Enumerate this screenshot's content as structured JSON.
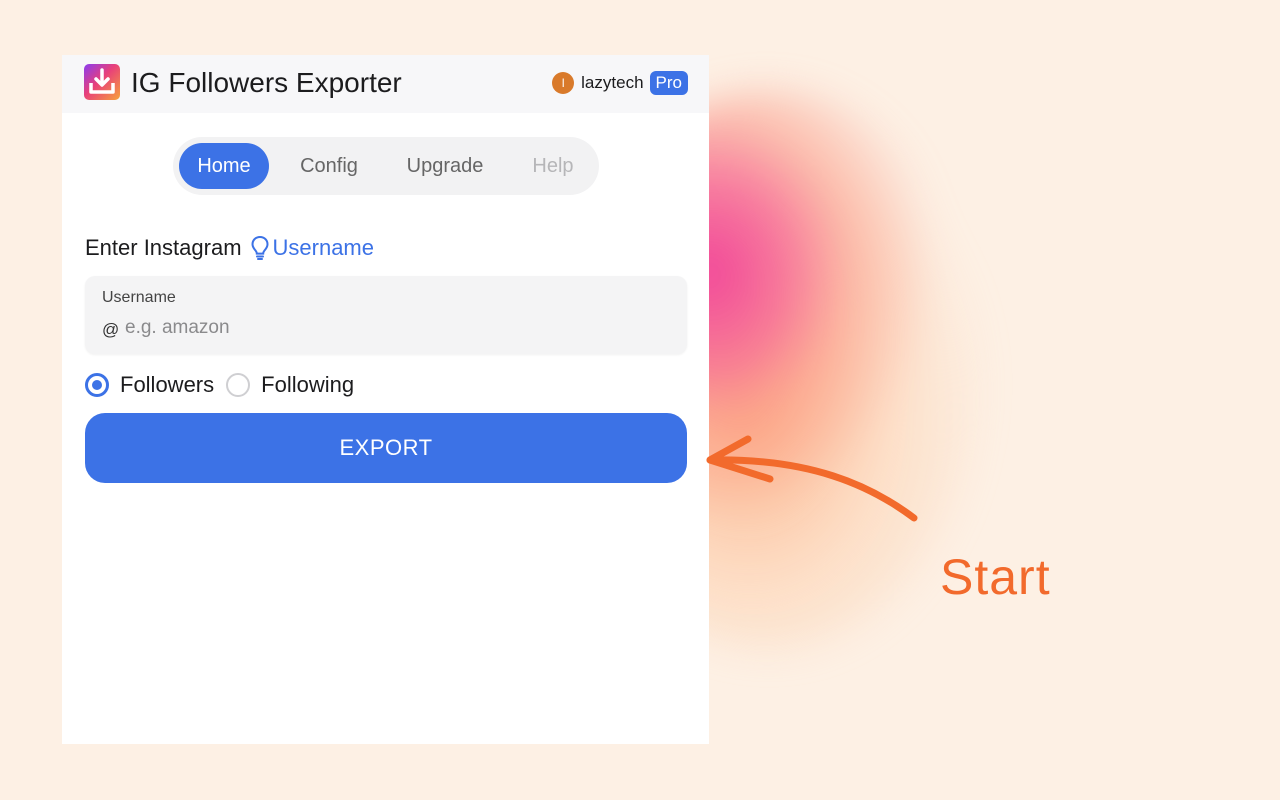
{
  "header": {
    "app_title": "IG Followers Exporter",
    "logo_icon": "download-tray-icon",
    "user": {
      "avatar_initial": "l",
      "name": "lazytech",
      "plan_badge": "Pro"
    }
  },
  "tabs": [
    {
      "label": "Home",
      "active": true
    },
    {
      "label": "Config",
      "active": false
    },
    {
      "label": "Upgrade",
      "active": false
    },
    {
      "label": "Help",
      "active": false,
      "disabled": true
    }
  ],
  "form": {
    "section_label_prefix": "Enter Instagram",
    "section_label_link": "Username",
    "hint_icon": "lightbulb-icon",
    "input": {
      "label": "Username",
      "prefix": "@",
      "value": "",
      "placeholder": "e.g. amazon"
    },
    "mode_options": [
      {
        "label": "Followers",
        "checked": true
      },
      {
        "label": "Following",
        "checked": false
      }
    ],
    "submit_label": "EXPORT"
  },
  "annotation": {
    "callout_text": "Start",
    "arrow_icon": "curved-arrow-icon"
  },
  "colors": {
    "accent": "#3c72e6",
    "callout": "#f26a2c",
    "background": "#fdf0e4"
  }
}
